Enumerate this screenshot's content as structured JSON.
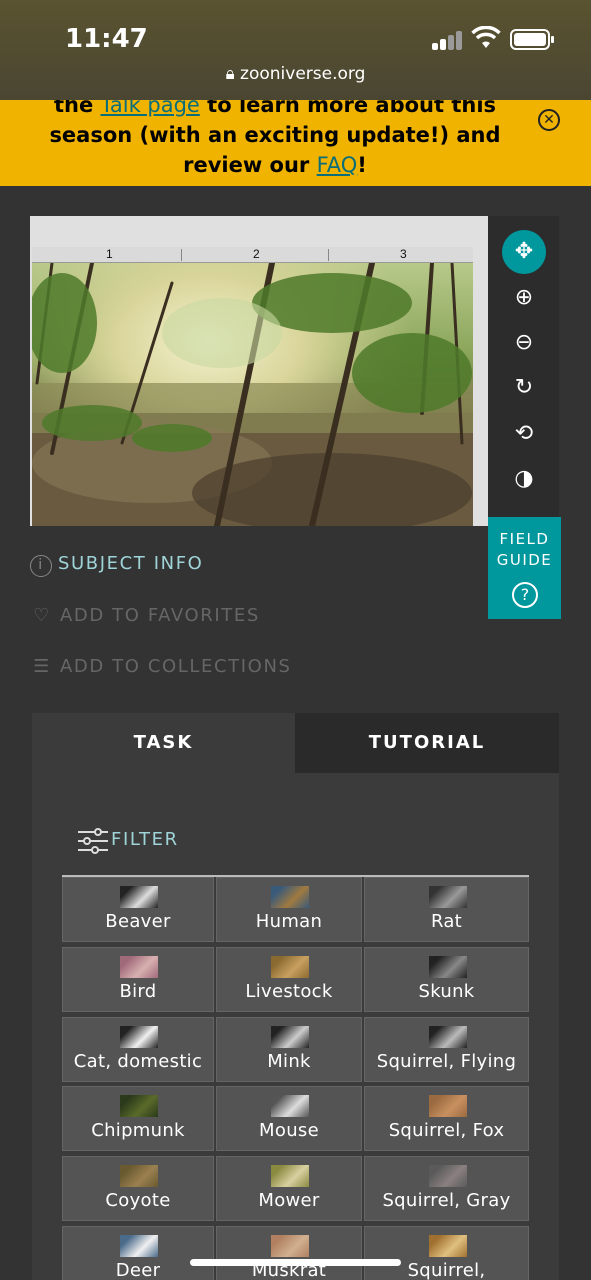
{
  "status_bar": {
    "time": "11:47",
    "url": "zooniverse.org"
  },
  "banner": {
    "line1_pre": "the ",
    "talk_link": "Talk page",
    "line1_post": " to learn more about this",
    "line2": "season (with an exciting update!) and",
    "line3_pre": "review our ",
    "faq_link": "FAQ",
    "line3_post": "!",
    "close_symbol": "✕"
  },
  "viewer": {
    "frames": [
      "1",
      "2",
      "3"
    ],
    "tools": [
      {
        "name": "move-icon",
        "symbol": "✥",
        "active": true
      },
      {
        "name": "zoom-in-icon",
        "symbol": "⊕",
        "active": false
      },
      {
        "name": "zoom-out-icon",
        "symbol": "⊖",
        "active": false
      },
      {
        "name": "rotate-icon",
        "symbol": "↻",
        "active": false
      },
      {
        "name": "reset-icon",
        "symbol": "⟲",
        "active": false
      },
      {
        "name": "invert-icon",
        "symbol": "◑",
        "active": false
      }
    ],
    "field_guide": {
      "line1": "FIELD",
      "line2": "GUIDE",
      "help": "?"
    }
  },
  "meta": {
    "subject_info": "SUBJECT INFO",
    "add_favorites": "ADD TO FAVORITES",
    "add_collections": "ADD TO COLLECTIONS"
  },
  "tabs": {
    "task": "TASK",
    "tutorial": "TUTORIAL"
  },
  "filter_label": "FILTER",
  "species": [
    {
      "label": "Beaver",
      "colors": [
        "#222",
        "#ddd"
      ]
    },
    {
      "label": "Human",
      "colors": [
        "#3a5a7a",
        "#a07a40"
      ]
    },
    {
      "label": "Rat",
      "colors": [
        "#333",
        "#999"
      ]
    },
    {
      "label": "Bird",
      "colors": [
        "#a06a7a",
        "#d8b0b0"
      ]
    },
    {
      "label": "Livestock",
      "colors": [
        "#8a6a30",
        "#c8a060"
      ]
    },
    {
      "label": "Skunk",
      "colors": [
        "#222",
        "#888"
      ]
    },
    {
      "label": "Cat, domestic",
      "colors": [
        "#222",
        "#f0f0f0"
      ]
    },
    {
      "label": "Mink",
      "colors": [
        "#222",
        "#ccc"
      ]
    },
    {
      "label": "Squirrel, Flying",
      "colors": [
        "#222",
        "#bbb"
      ]
    },
    {
      "label": "Chipmunk",
      "colors": [
        "#2a3a1a",
        "#5a6a2a"
      ]
    },
    {
      "label": "Mouse",
      "colors": [
        "#555",
        "#ddd"
      ]
    },
    {
      "label": "Squirrel, Fox",
      "colors": [
        "#9a6a40",
        "#c89060"
      ]
    },
    {
      "label": "Coyote",
      "colors": [
        "#6a5a30",
        "#9a8050"
      ]
    },
    {
      "label": "Mower",
      "colors": [
        "#8a8a40",
        "#d8d0a0"
      ]
    },
    {
      "label": "Squirrel, Gray",
      "colors": [
        "#5a5a5a",
        "#8a8080"
      ]
    },
    {
      "label": "Deer",
      "colors": [
        "#4a6a8a",
        "#f0f0f0"
      ]
    },
    {
      "label": "Muskrat",
      "colors": [
        "#b08060",
        "#d0b090"
      ]
    },
    {
      "label": "Squirrel,",
      "colors": [
        "#a07030",
        "#e0c080"
      ]
    }
  ]
}
